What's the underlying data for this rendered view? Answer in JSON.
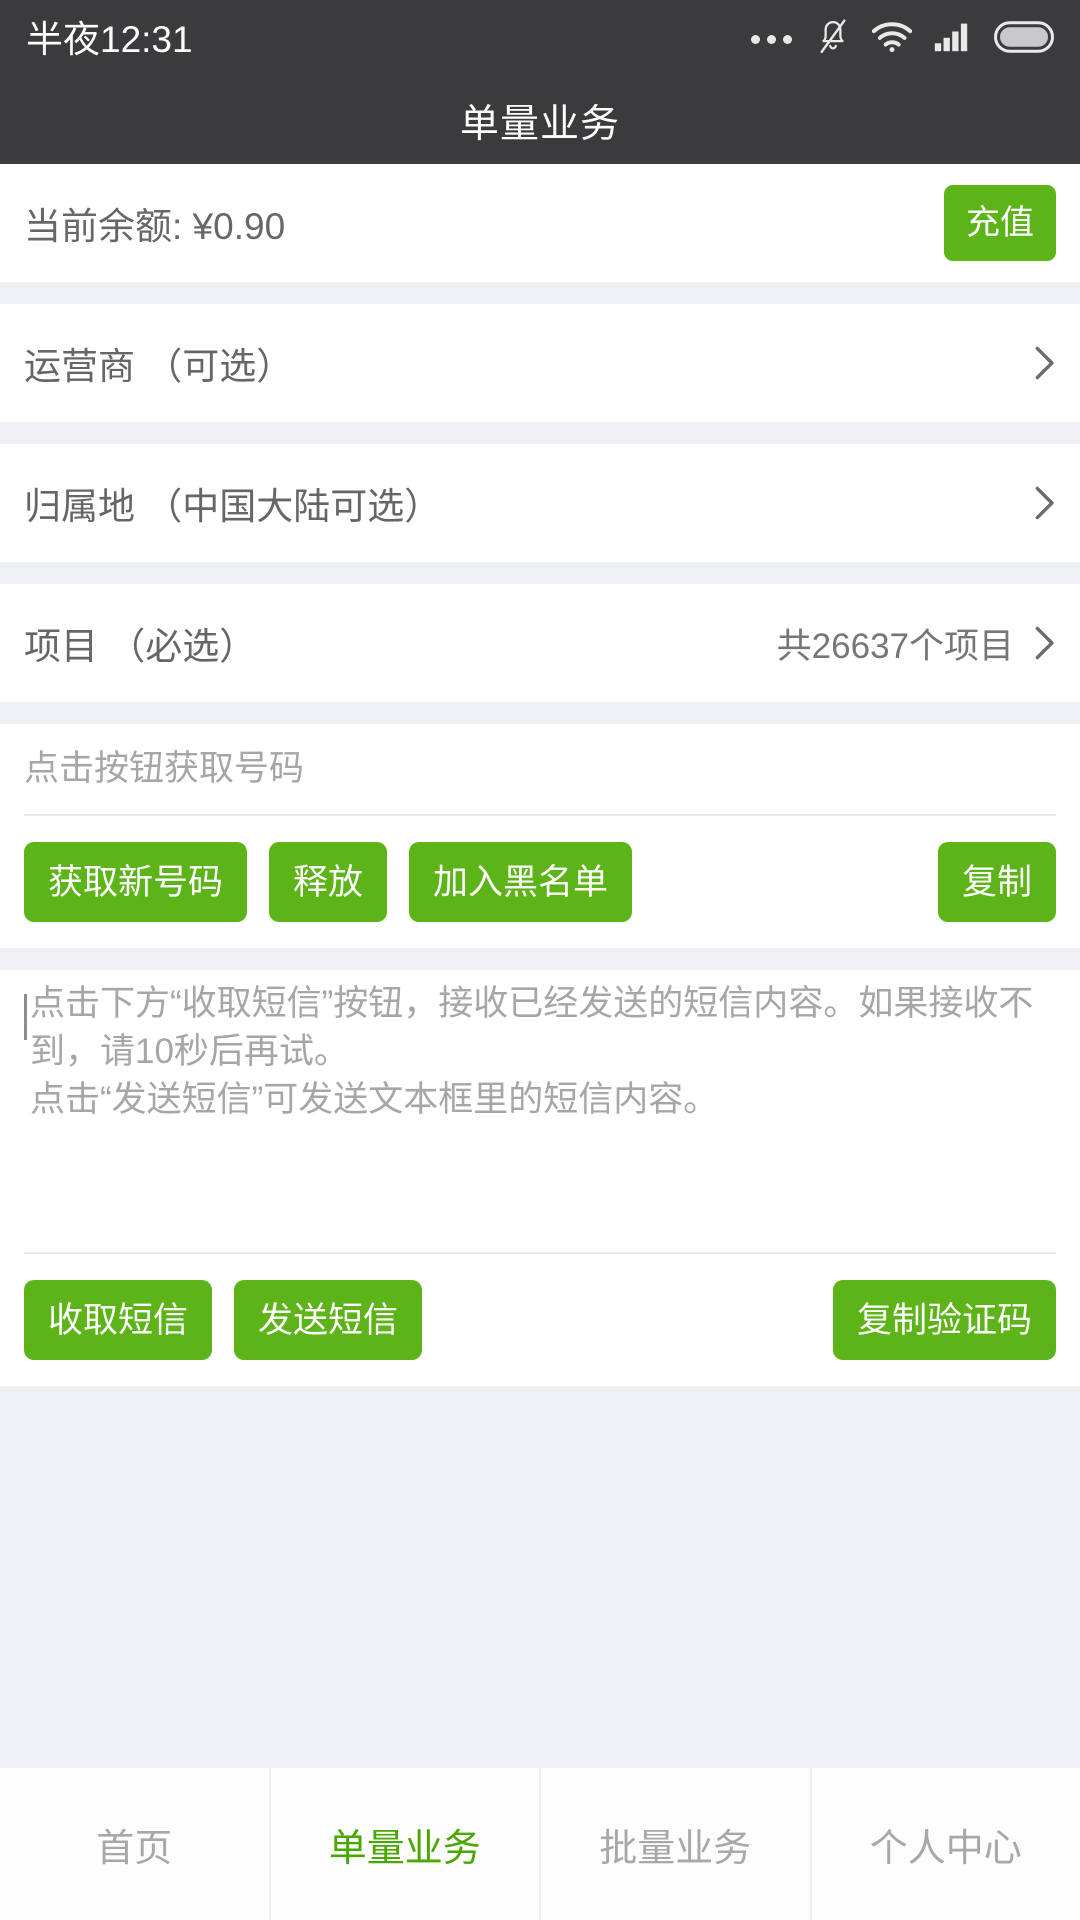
{
  "statusbar": {
    "time": "半夜12:31",
    "icons": [
      "more-dots-icon",
      "bell-muted-icon",
      "wifi-icon",
      "signal-icon",
      "battery-icon"
    ]
  },
  "header": {
    "title": "单量业务"
  },
  "balance": {
    "label": "当前余额: ¥0.90",
    "recharge_label": "充值"
  },
  "rows": [
    {
      "label": "运营商 （可选）",
      "value": ""
    },
    {
      "label": "归属地 （中国大陆可选）",
      "value": ""
    },
    {
      "label": "项目 （必选）",
      "value": "共26637个项目"
    }
  ],
  "number_section": {
    "placeholder": "点击按钮获取号码",
    "value": "",
    "buttons": {
      "get_new": "获取新号码",
      "release": "释放",
      "blacklist": "加入黑名单",
      "copy": "复制"
    }
  },
  "sms_section": {
    "placeholder": "点击下方“收取短信”按钮，接收已经发送的短信内容。如果接收不到，请10秒后再试。\n点击“发送短信”可发送文本框里的短信内容。",
    "value": "",
    "buttons": {
      "receive": "收取短信",
      "send": "发送短信",
      "copy_code": "复制验证码"
    }
  },
  "tabbar": {
    "tabs": [
      {
        "label": "首页",
        "active": false
      },
      {
        "label": "单量业务",
        "active": true
      },
      {
        "label": "批量业务",
        "active": false
      },
      {
        "label": "个人中心",
        "active": false
      }
    ]
  },
  "colors": {
    "brand_green": "#5cb418",
    "active_tab_green": "#49a800",
    "header_bg": "#3b3b3d",
    "page_bg": "#eff0f4"
  }
}
